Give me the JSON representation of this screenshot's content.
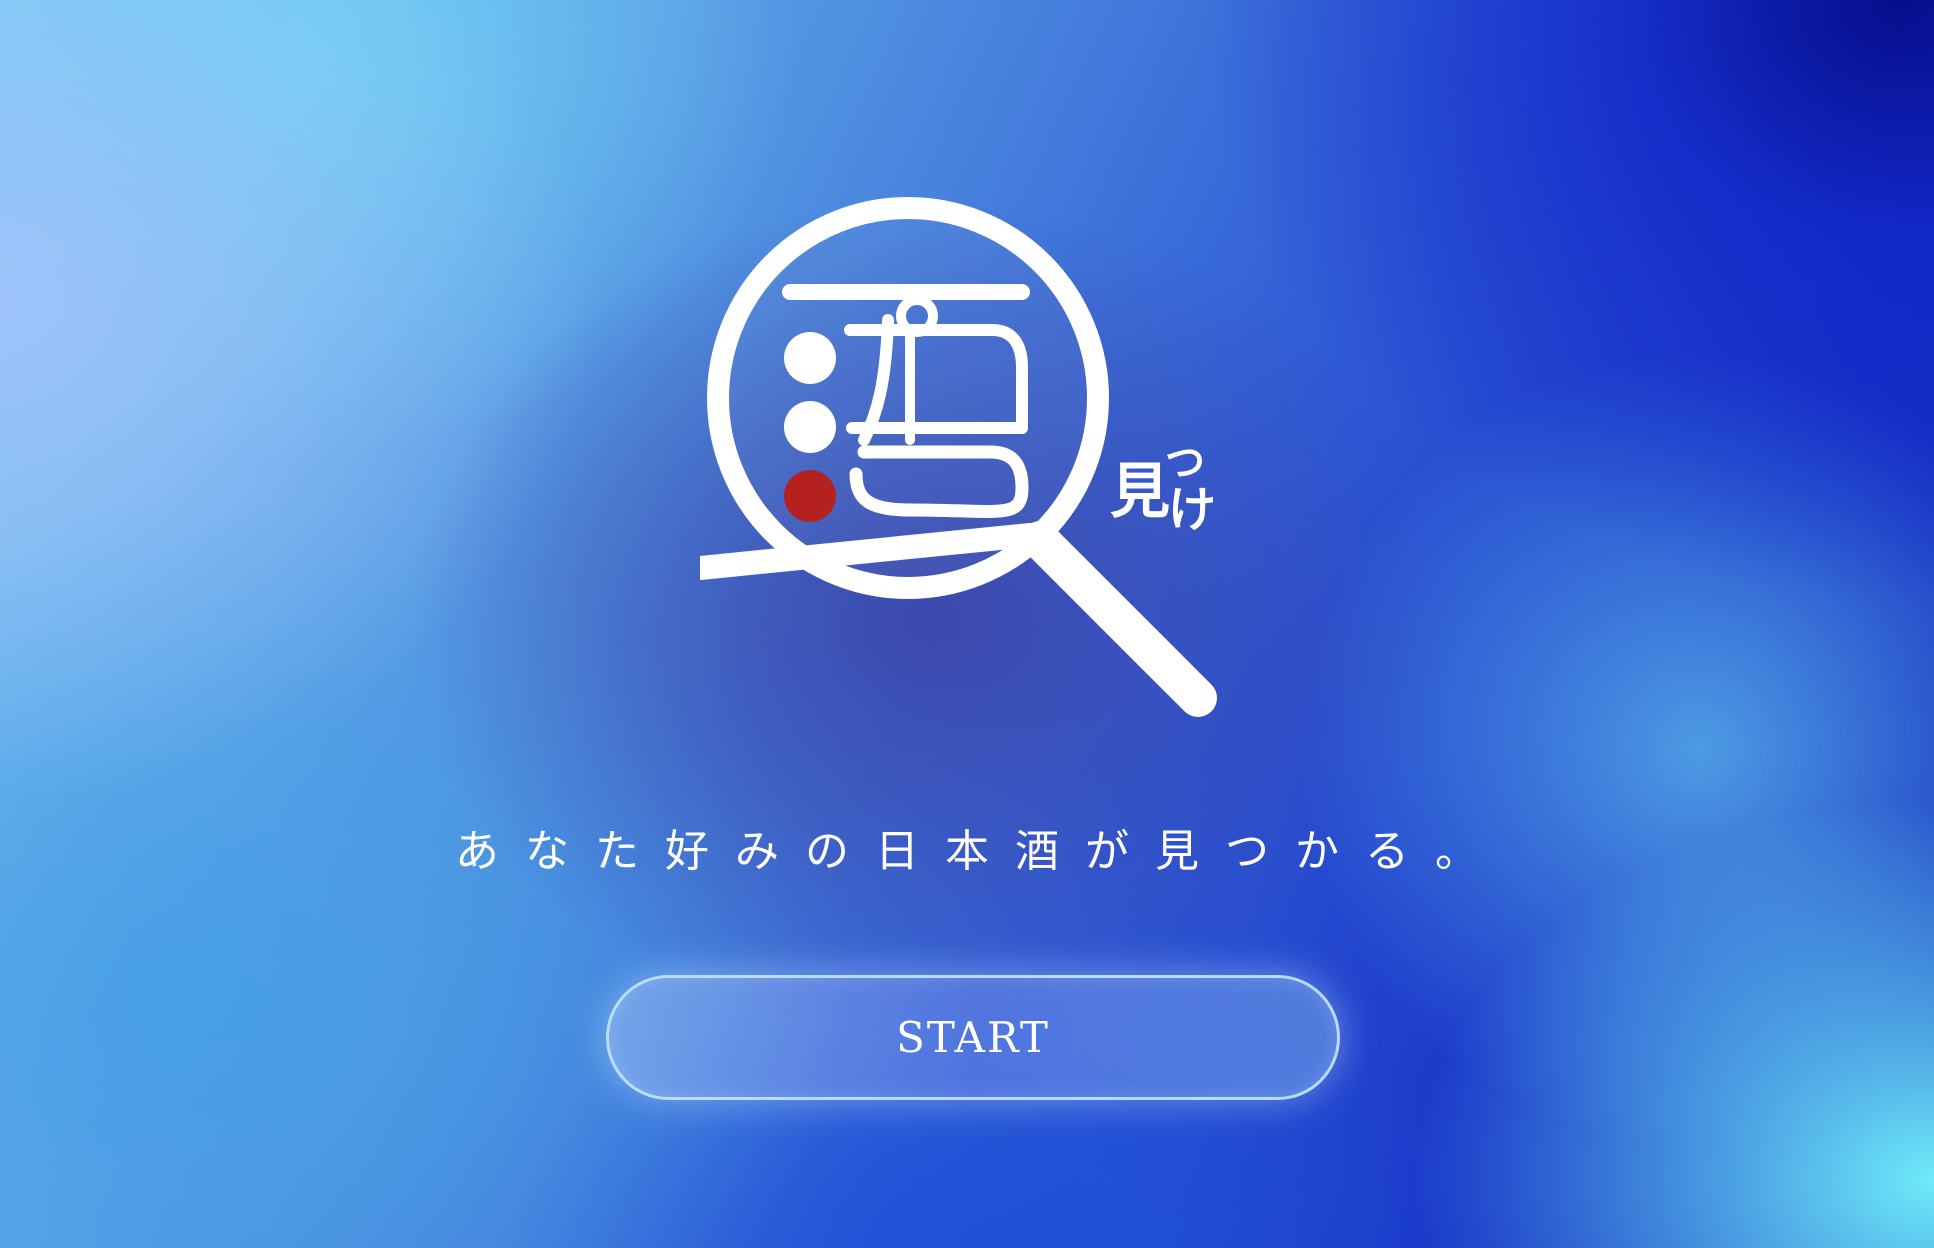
{
  "logo": {
    "kanji": "酒",
    "subtitle_main": "見",
    "subtitle_small_1": "つ",
    "subtitle_small_2": "け",
    "icon": "magnifying-glass-icon",
    "accent_dot_color": "#b5211f"
  },
  "tagline": "あなた好みの日本酒が見つかる。",
  "start_button": {
    "label": "START"
  },
  "colors": {
    "text": "#ffffff",
    "accent": "#b5211f"
  }
}
